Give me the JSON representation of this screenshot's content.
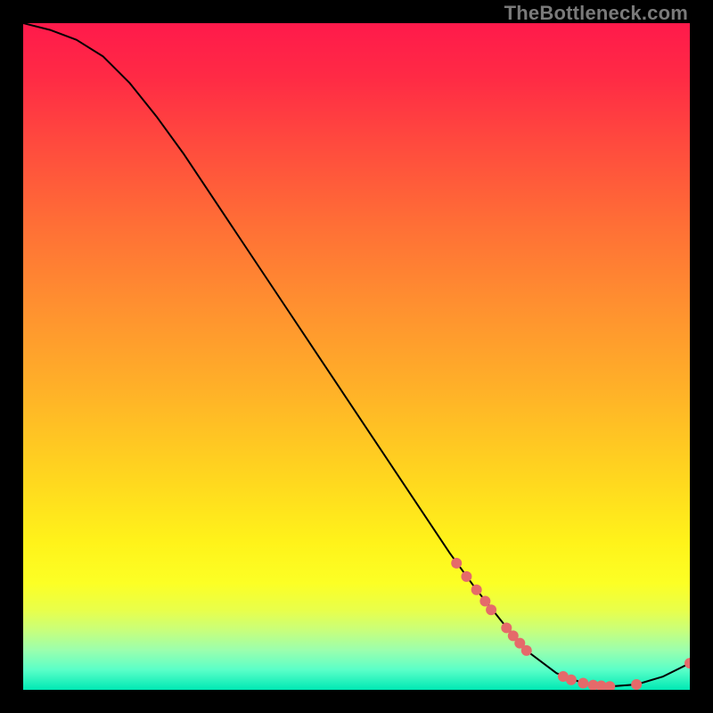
{
  "watermark": "TheBottleneck.com",
  "chart_data": {
    "type": "line",
    "title": "",
    "xlabel": "",
    "ylabel": "",
    "xlim": [
      0,
      100
    ],
    "ylim": [
      0,
      100
    ],
    "grid": false,
    "legend": false,
    "series": [
      {
        "name": "curve",
        "color": "#000000",
        "x": [
          0,
          4,
          8,
          12,
          16,
          20,
          24,
          28,
          32,
          36,
          40,
          44,
          48,
          52,
          56,
          60,
          64,
          68,
          72,
          76,
          80,
          84,
          88,
          92,
          96,
          100
        ],
        "y": [
          100,
          99,
          97.5,
          95,
          91,
          86,
          80.5,
          74.5,
          68.5,
          62.5,
          56.5,
          50.5,
          44.5,
          38.5,
          32.5,
          26.5,
          20.5,
          15,
          10,
          5.5,
          2.5,
          1,
          0.5,
          0.8,
          2,
          4
        ]
      }
    ],
    "markers": {
      "name": "highlight-points",
      "color": "#e56a6a",
      "radius_px": 6,
      "points": [
        {
          "x": 65,
          "y": 19
        },
        {
          "x": 66.5,
          "y": 17
        },
        {
          "x": 68,
          "y": 15
        },
        {
          "x": 69.3,
          "y": 13.3
        },
        {
          "x": 70.2,
          "y": 12
        },
        {
          "x": 72.5,
          "y": 9.3
        },
        {
          "x": 73.5,
          "y": 8.1
        },
        {
          "x": 74.5,
          "y": 7
        },
        {
          "x": 75.5,
          "y": 5.9
        },
        {
          "x": 81,
          "y": 2
        },
        {
          "x": 82.2,
          "y": 1.5
        },
        {
          "x": 84,
          "y": 1
        },
        {
          "x": 85.5,
          "y": 0.7
        },
        {
          "x": 86.7,
          "y": 0.6
        },
        {
          "x": 88,
          "y": 0.5
        },
        {
          "x": 92,
          "y": 0.8
        },
        {
          "x": 100,
          "y": 4
        }
      ]
    }
  }
}
